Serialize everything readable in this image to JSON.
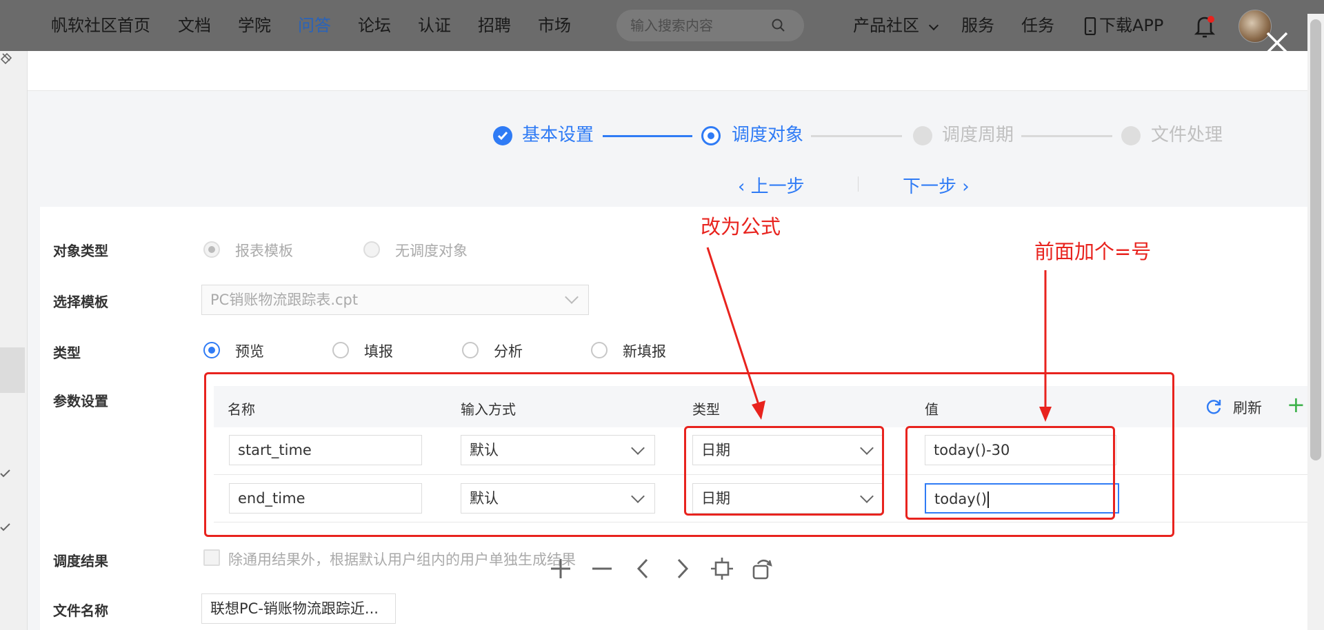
{
  "nav": {
    "items": [
      "帆软社区首页",
      "文档",
      "学院",
      "问答",
      "论坛",
      "认证",
      "招聘",
      "市场"
    ],
    "search_placeholder": "输入搜索内容",
    "product_community": "产品社区",
    "services": "服务",
    "tasks": "任务",
    "download_app": "下载APP"
  },
  "steps": [
    "基本设置",
    "调度对象",
    "调度周期",
    "文件处理"
  ],
  "step_nav": {
    "prev": "上一步",
    "next": "下一步"
  },
  "form": {
    "object_type_label": "对象类型",
    "object_type_options": [
      "报表模板",
      "无调度对象"
    ],
    "template_label": "选择模板",
    "template_value": "PC销账物流跟踪表.cpt",
    "type_label": "类型",
    "type_options": [
      "预览",
      "填报",
      "分析",
      "新填报"
    ],
    "params_label": "参数设置",
    "params_headers": [
      "名称",
      "输入方式",
      "类型",
      "值"
    ],
    "refresh": "刷新",
    "params_rows": [
      {
        "name": "start_time",
        "input": "默认",
        "type": "日期",
        "value": "today()-30"
      },
      {
        "name": "end_time",
        "input": "默认",
        "type": "日期",
        "value": "today()"
      }
    ],
    "result_label": "调度结果",
    "result_checkbox": "除通用结果外，根据默认用户组内的用户单独生成结果",
    "filename_label": "文件名称",
    "filename_value": "联想PC-销账物流跟踪近..."
  },
  "annotations": {
    "change_to_formula": "改为公式",
    "add_equals": "前面加个=号"
  },
  "colors": {
    "accent": "#2f7bf5",
    "annotation": "#e8231e",
    "topbar": "#6b6b6b"
  }
}
